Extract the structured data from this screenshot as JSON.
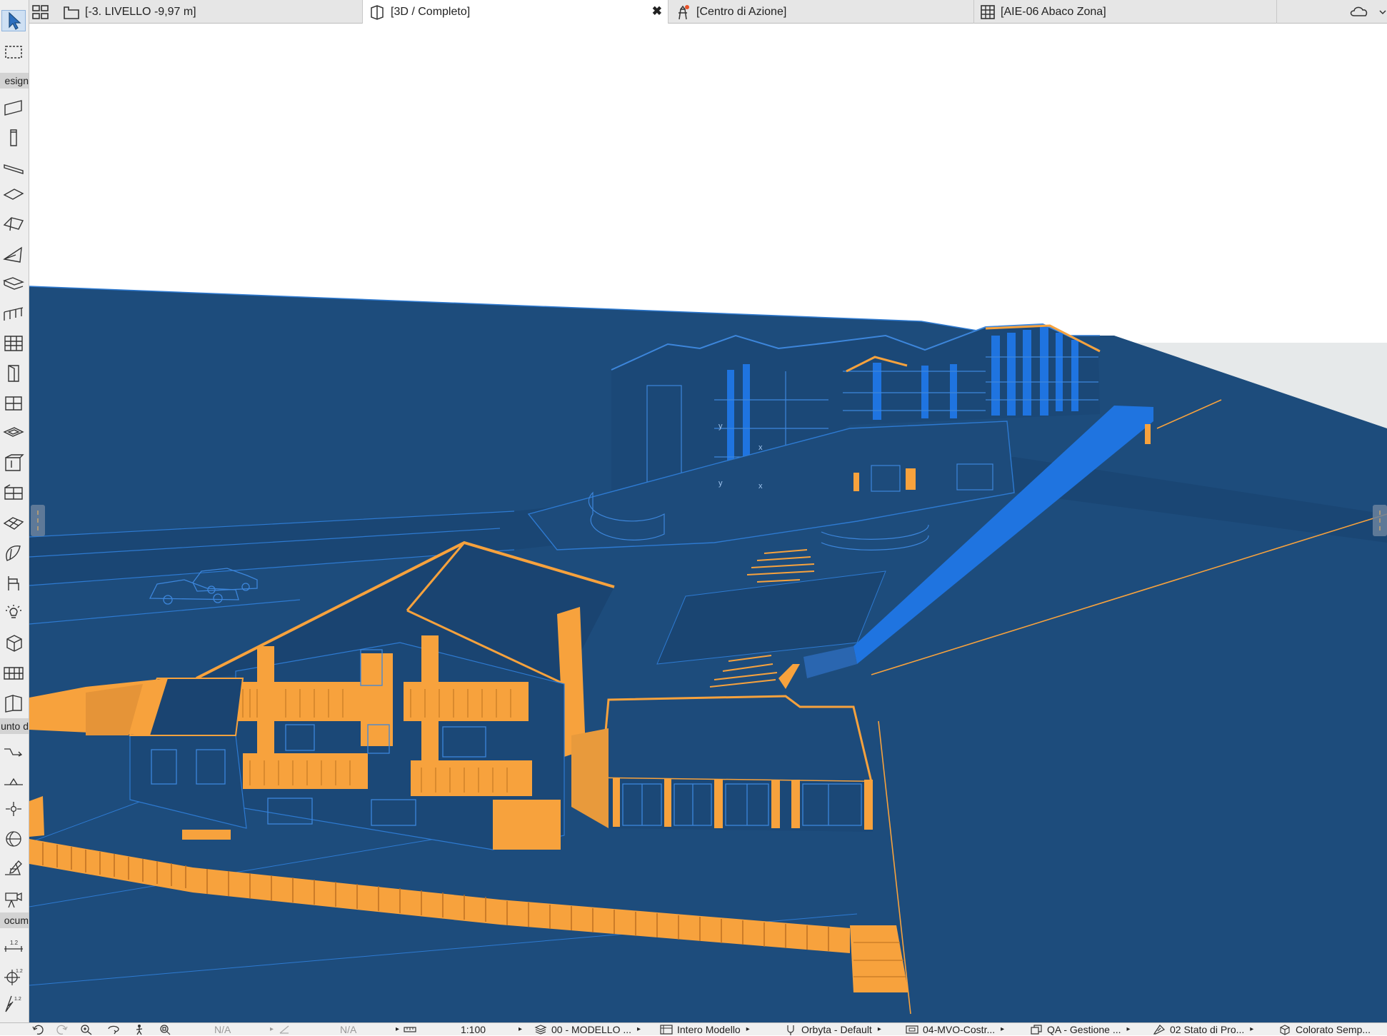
{
  "tabs": [
    {
      "label": "[-3. LIVELLO -9,97 m]",
      "icon": "floor-plan-icon"
    },
    {
      "label": "[3D / Completo]",
      "icon": "3d-window-icon",
      "active": true,
      "close_label": "✖"
    },
    {
      "label": "[Centro di Azione]",
      "icon": "action-center-icon"
    },
    {
      "label": "[AIE-06 Abaco Zona]",
      "icon": "schedule-icon"
    }
  ],
  "toolbox": {
    "sections": [
      "esign",
      "unto d",
      "ocum"
    ]
  },
  "statusbar": {
    "na_1": "N/A",
    "na_2": "N/A",
    "scale": "1:100",
    "layer_combo": "00 - MODELLO ...",
    "model_view": "Intero Modello",
    "pen_set": "Orbyta - Default",
    "model_view_option": "04-MVO-Costr...",
    "graphic_override": "QA - Gestione ...",
    "renovation": "02 Stato di Pro...",
    "style_3d": "Colorato Semp..."
  },
  "scene": {
    "colors": {
      "ground": "#1d4c7c",
      "ground_dark": "#173f69",
      "edge_blue": "#2e7ad1",
      "bright_blue": "#1f74e0",
      "orange": "#f7a23d",
      "orange_light": "#fbb04f",
      "sky": "#ffffff",
      "far_plane": "#e6e9ea"
    }
  }
}
